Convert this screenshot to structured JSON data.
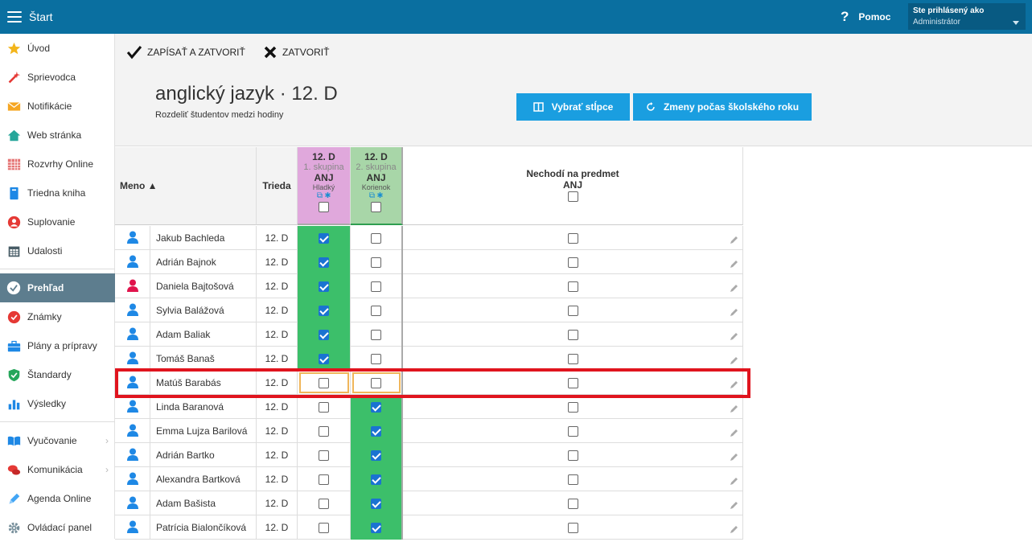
{
  "topbar": {
    "title": "Štart",
    "help_label": "Pomoc",
    "user_line1": "Ste prihlásený ako",
    "user_line2": "Administrátor"
  },
  "sidebar": {
    "items": [
      {
        "label": "Úvod",
        "icon": "star-icon"
      },
      {
        "label": "Sprievodca",
        "icon": "wand-icon"
      },
      {
        "label": "Notifikácie",
        "icon": "envelope-icon"
      },
      {
        "label": "Web stránka",
        "icon": "home-icon"
      },
      {
        "label": "Rozvrhy Online",
        "icon": "calendar-grid-icon"
      },
      {
        "label": "Triedna kniha",
        "icon": "book-icon"
      },
      {
        "label": "Suplovanie",
        "icon": "person-icon"
      },
      {
        "label": "Udalosti",
        "icon": "calendar-icon"
      },
      {
        "label": "Prehľad",
        "icon": "check-circle-icon"
      },
      {
        "label": "Známky",
        "icon": "grade-icon"
      },
      {
        "label": "Plány a prípravy",
        "icon": "briefcase-icon"
      },
      {
        "label": "Štandardy",
        "icon": "shield-icon"
      },
      {
        "label": "Výsledky",
        "icon": "bar-chart-icon"
      },
      {
        "label": "Vyučovanie",
        "icon": "open-book-icon"
      },
      {
        "label": "Komunikácia",
        "icon": "chat-icon"
      },
      {
        "label": "Agenda Online",
        "icon": "pen-icon"
      },
      {
        "label": "Ovládací panel",
        "icon": "gear-icon"
      }
    ]
  },
  "toolbar": {
    "save_close": "ZAPÍSAŤ A ZATVORIŤ",
    "close": "ZATVORIŤ"
  },
  "page": {
    "title": "anglický jazyk · 12. D",
    "subtitle": "Rozdeliť študentov medzi hodiny",
    "btn_columns": "Vybrať stĺpce",
    "btn_changes": "Zmeny počas školského roku"
  },
  "table": {
    "col_name": "Meno ▲",
    "col_class": "Trieda",
    "group1": {
      "class": "12. D",
      "name": "1. skupina",
      "subject": "ANJ",
      "teacher": "Hladký"
    },
    "group2": {
      "class": "12. D",
      "name": "2. skupina",
      "subject": "ANJ",
      "teacher": "Korienok"
    },
    "none_title": "Nechodí na predmet",
    "none_subject": "ANJ",
    "rows": [
      {
        "name": "Jakub Bachleda",
        "class": "12. D",
        "g1": true,
        "g2": false,
        "female": false
      },
      {
        "name": "Adrián Bajnok",
        "class": "12. D",
        "g1": true,
        "g2": false,
        "female": false
      },
      {
        "name": "Daniela Bajtošová",
        "class": "12. D",
        "g1": true,
        "g2": false,
        "female": true
      },
      {
        "name": "Sylvia Balážová",
        "class": "12. D",
        "g1": true,
        "g2": false,
        "female": false
      },
      {
        "name": "Adam Baliak",
        "class": "12. D",
        "g1": true,
        "g2": false,
        "female": false
      },
      {
        "name": "Tomáš Banaš",
        "class": "12. D",
        "g1": true,
        "g2": false,
        "female": false
      },
      {
        "name": "Matúš Barabás",
        "class": "12. D",
        "g1": false,
        "g2": false,
        "female": false
      },
      {
        "name": "Linda Baranová",
        "class": "12. D",
        "g1": false,
        "g2": true,
        "female": false
      },
      {
        "name": "Emma Lujza Barilová",
        "class": "12. D",
        "g1": false,
        "g2": true,
        "female": false
      },
      {
        "name": "Adrián Bartko",
        "class": "12. D",
        "g1": false,
        "g2": true,
        "female": false
      },
      {
        "name": "Alexandra Bartková",
        "class": "12. D",
        "g1": false,
        "g2": true,
        "female": false
      },
      {
        "name": "Adam Bašista",
        "class": "12. D",
        "g1": false,
        "g2": true,
        "female": false
      },
      {
        "name": "Patrícia Bialončíková",
        "class": "12. D",
        "g1": false,
        "g2": true,
        "female": false
      }
    ]
  },
  "colors": {
    "topbar": "#0a6fa0",
    "accent": "#1a9ee0",
    "group1": "#e0a8dc",
    "group2": "#a8d6a8",
    "checked_cell": "#3cbf6a",
    "highlight": "#e0141e"
  }
}
